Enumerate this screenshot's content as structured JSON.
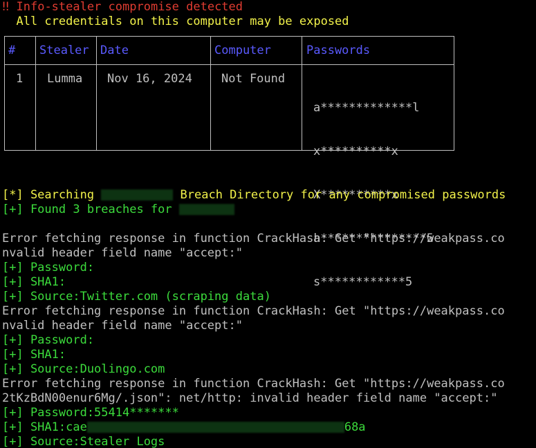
{
  "alert": {
    "marker": "‼",
    "title": "Info-stealer compromise detected",
    "subtitle": "All credentials on this computer may be exposed"
  },
  "table": {
    "headers": [
      "#",
      "Stealer",
      "Date",
      "Computer",
      "Passwords"
    ],
    "row": {
      "index": "1",
      "stealer": "Lumma",
      "date": "Nov 16, 2024",
      "computer": "Not Found",
      "passwords": [
        "a*************l",
        "x**********x",
        "X**********x",
        "a***************5",
        "s************5"
      ]
    }
  },
  "log": {
    "search_prefix": "[*] Searching ",
    "search_suffix": " Breach Directory for any compromised passwords",
    "found_prefix": "[+] Found 3 breaches for ",
    "lines": [
      {
        "text": "Error fetching response in function CrackHash: Get \"https://weakpass.co",
        "color": "gray"
      },
      {
        "text": "nvalid header field name \"accept:\"",
        "color": "gray"
      },
      {
        "text": "[+] Password:",
        "color": "green"
      },
      {
        "text": "[+] SHA1:",
        "color": "green"
      },
      {
        "text": "[+] Source:Twitter.com (scraping data)",
        "color": "green"
      },
      {
        "text": "Error fetching response in function CrackHash: Get \"https://weakpass.co",
        "color": "gray"
      },
      {
        "text": "nvalid header field name \"accept:\"",
        "color": "gray"
      },
      {
        "text": "[+] Password:",
        "color": "green"
      },
      {
        "text": "[+] SHA1:",
        "color": "green"
      },
      {
        "text": "[+] Source:Duolingo.com",
        "color": "green"
      },
      {
        "text": "Error fetching response in function CrackHash: Get \"https://weakpass.co",
        "color": "gray"
      },
      {
        "text": "2tKzBdN00enur6Mg/.json\": net/http: invalid header field name \"accept:\"",
        "color": "gray"
      },
      {
        "text": "[+] Password:55414*******",
        "color": "green"
      }
    ],
    "sha1_prefix": "[+] SHA1:cae",
    "sha1_suffix": "68a",
    "last_source": "[+] Source:Stealer Logs"
  },
  "colors": {
    "background": "#000000",
    "red": "#e03c31",
    "yellow": "#f2f24a",
    "green": "#3cdc3c",
    "gray": "#c0c0c0",
    "blue": "#5a5aff"
  }
}
